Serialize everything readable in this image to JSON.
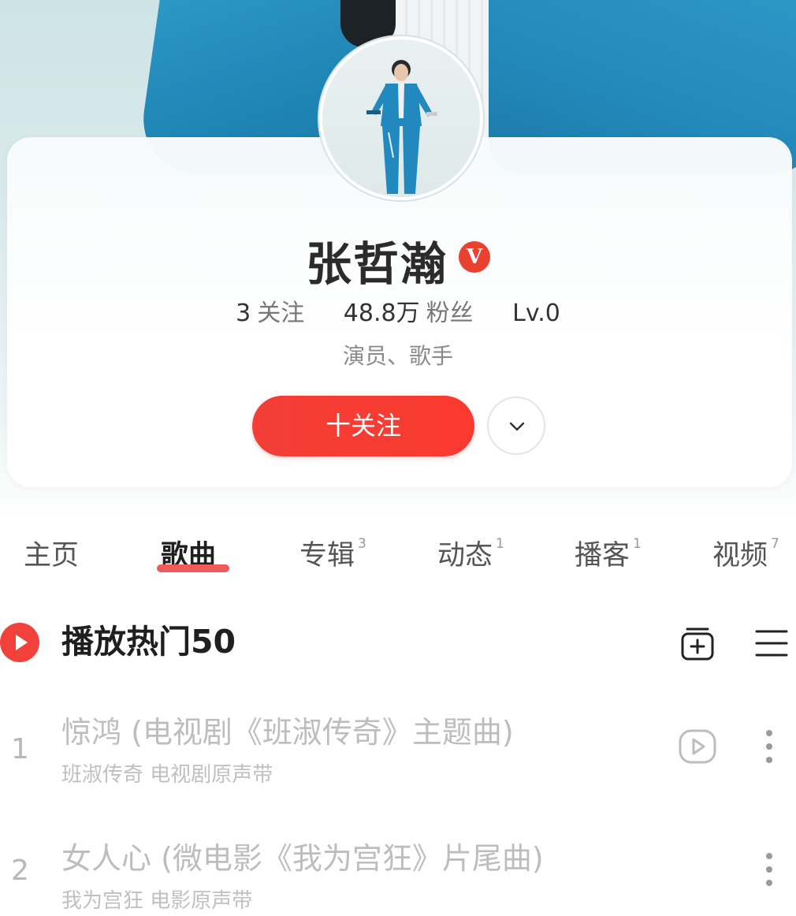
{
  "profile": {
    "name": "张哲瀚",
    "badge": "V",
    "stats": [
      {
        "num": "3",
        "label": "关注"
      },
      {
        "num": "48.8万",
        "label": "粉丝"
      },
      {
        "num": "Lv.0",
        "label": ""
      }
    ],
    "tagline": "演员、歌手",
    "follow_label": "十关注"
  },
  "tabs": [
    {
      "label": "主页",
      "count": ""
    },
    {
      "label": "歌曲",
      "count": ""
    },
    {
      "label": "专辑",
      "count": "3"
    },
    {
      "label": "动态",
      "count": "1"
    },
    {
      "label": "播客",
      "count": "1"
    },
    {
      "label": "视频",
      "count": "7"
    }
  ],
  "active_tab": "歌曲",
  "playlist": {
    "title": "播放热门50"
  },
  "songs": [
    {
      "index": "1",
      "title": "惊鸿 (电视剧《班淑传奇》主题曲)",
      "subtitle": "班淑传奇 电视剧原声带",
      "has_mv": true
    },
    {
      "index": "2",
      "title": "女人心 (微电影《我为宫狂》片尾曲)",
      "subtitle": "我为宫狂 电影原声带",
      "has_mv": false
    }
  ],
  "colors": {
    "accent": "#f2413a",
    "jacket": "#2389bb",
    "tab_underline": "#ef5a5a"
  },
  "icons": {
    "play": "play-icon",
    "add_to_playlist": "add-playlist-icon",
    "menu": "menu-icon",
    "mv": "mv-play-icon",
    "more": "more-dots-icon",
    "expand": "chevron-down-icon"
  }
}
